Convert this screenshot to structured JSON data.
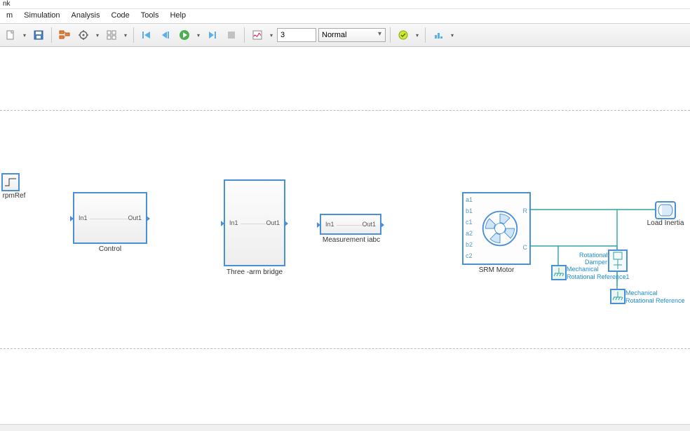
{
  "app": {
    "title": "nk"
  },
  "menus": [
    "m",
    "Simulation",
    "Analysis",
    "Code",
    "Tools",
    "Help"
  ],
  "toolbar": {
    "newModel": "new-model",
    "open": "open",
    "save": "save",
    "modelExplorer": "model-explorer",
    "libraryBrowser": "library-browser",
    "modelConfig": "model-config",
    "stepBack": "step-back",
    "stepBackOne": "step-back-one",
    "run": "run",
    "stepFwd": "step-forward",
    "stop": "stop",
    "scope": "scope",
    "stopTime": "3",
    "simMode": "Normal",
    "build": "build",
    "deploy": "deploy"
  },
  "blocks": {
    "rpmRef": {
      "label": "rpmRef"
    },
    "control": {
      "label": "Control",
      "in": "In1",
      "out": "Out1"
    },
    "bridge": {
      "label": "Three -arm bridge",
      "in": "In1",
      "out": "Out1"
    },
    "meas": {
      "label": "Measurement iabc",
      "in": "In1",
      "out": "Out1"
    },
    "srm": {
      "label": "SRM Motor",
      "pa1": "a1",
      "pb1": "b1",
      "pc1": "c1",
      "pa2": "a2",
      "pb2": "b2",
      "pc2": "c2",
      "pR": "R",
      "pC": "C"
    },
    "damper": {
      "label": "Rotational Damper"
    },
    "inertia": {
      "label": "Load Inertia"
    },
    "mref1": {
      "label1": "Mechanical",
      "label2": "Rotational Reference1"
    },
    "mref2": {
      "label1": "Mechanical",
      "label2": "Rotational Reference"
    }
  }
}
